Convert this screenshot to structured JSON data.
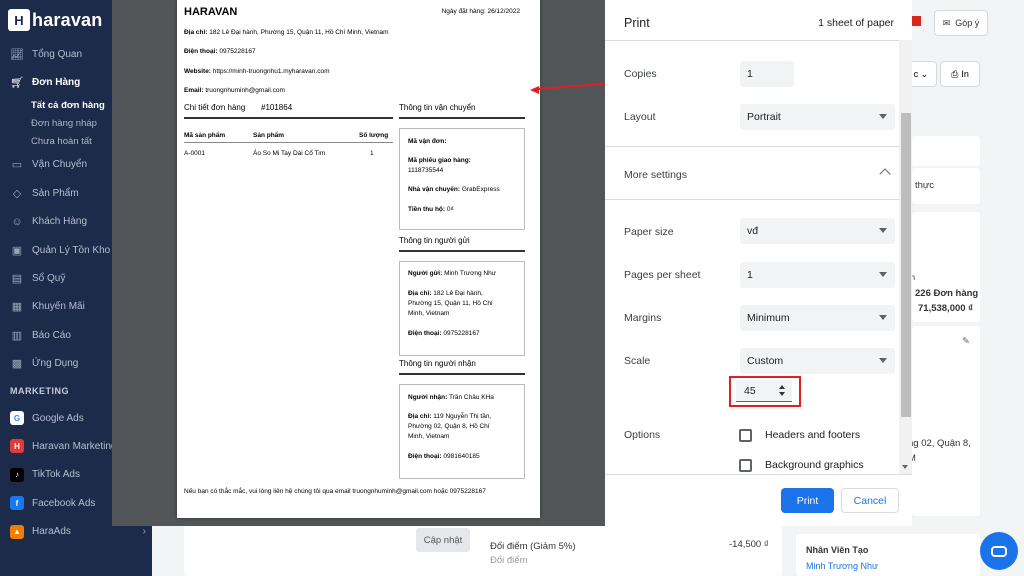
{
  "sidebar": {
    "logo": "haravan",
    "items": [
      {
        "label": "Tổng Quan",
        "icon": "chart-line-icon"
      },
      {
        "label": "Đơn Hàng",
        "icon": "cart-icon"
      },
      {
        "label": "Vận Chuyển",
        "icon": "truck-icon"
      },
      {
        "label": "Sản Phẩm",
        "icon": "tag-icon"
      },
      {
        "label": "Khách Hàng",
        "icon": "user-icon"
      },
      {
        "label": "Quản Lý Tồn Kho",
        "icon": "box-icon"
      },
      {
        "label": "Sổ Quỹ",
        "icon": "wallet-icon"
      },
      {
        "label": "Khuyến Mãi",
        "icon": "gift-icon"
      },
      {
        "label": "Báo Cáo",
        "icon": "report-icon"
      },
      {
        "label": "Ứng Dụng",
        "icon": "apps-icon"
      }
    ],
    "subitems": [
      "Tất cả đơn hàng",
      "Đơn hàng nháp",
      "Chưa hoàn tất"
    ],
    "marketing_title": "MARKETING",
    "marketing": [
      "Google Ads",
      "Haravan Marketing",
      "TikTok Ads",
      "Facebook Ads",
      "HaraAds"
    ]
  },
  "header": {
    "help": "Góp ý",
    "print_btn": "In"
  },
  "background": {
    "text_thuc": "thực",
    "text_m": "m",
    "orders": "226 Đơn hàng",
    "amount": "71,538,000 ₫",
    "addr_line1": "ng 02, Quận 8,",
    "addr_line2": "M",
    "update_btn": "Cập nhật",
    "points_label": "Đổi điểm (Giảm 5%)",
    "points_value": "-14,500 ₫",
    "points_label2": "Đổi điểm",
    "staff_title": "Nhân Viên Tạo",
    "staff_name": "Minh Trương Như"
  },
  "sheet": {
    "store": "HARAVAN",
    "order_date": "Ngày đặt hàng: 26/12/2022",
    "address_label": "Địa chỉ:",
    "address": "182 Lê Đại hành, Phường 15, Quận 11, Hồ Chí Minh, Vietnam",
    "phone_label": "Điện thoại:",
    "phone": "0975228167",
    "website_label": "Website:",
    "website": "https://minh-truongnhu1.myharavan.com",
    "email_label": "Email:",
    "email": "truongnhuminh@gmail.com",
    "detail_title": "Chi tiết đơn hàng",
    "order_no": "#101864",
    "col_sku": "Mã sản phẩm",
    "col_product": "Sản phẩm",
    "col_qty": "Số lượng",
    "row_sku": "A-0001",
    "row_product": "Áo So Mi Tay Dài Cổ Tim",
    "row_qty": "1",
    "ship_title": "Thông tin vận chuyển",
    "ship_code": "Mã vận đơn:",
    "ship_slip_label": "Mã phiếu giao hàng:",
    "ship_slip": "1118735544",
    "carrier_label": "Nhà vận chuyển:",
    "carrier": "GrabExpress",
    "cod_label": "Tiền thu hộ:",
    "cod": "0₫",
    "sender_title": "Thông tin người gửi",
    "sender_label": "Người gửi:",
    "sender": "Minh Trương Như",
    "sender_addr_label": "Địa chỉ:",
    "sender_addr1": "182 Lê Đại hành,",
    "sender_addr2": "Phường 15, Quận 11, Hồ Chí",
    "sender_addr3": "Minh, Vietnam",
    "sender_phone_label": "Điện thoại:",
    "sender_phone": "0975228167",
    "receiver_title": "Thông tin người nhận",
    "receiver_label": "Người nhận:",
    "receiver": "Trần Châu KHa",
    "receiver_addr_label": "Địa chỉ:",
    "receiver_addr1": "119 Nguyễn Thị tần,",
    "receiver_addr2": "Phường 02, Quận 8, Hồ Chí",
    "receiver_addr3": "Minh, Vietnam",
    "receiver_phone_label": "Điện thoại:",
    "receiver_phone": "0981640185",
    "footer": "Nếu bạn có thắc mắc, vui lòng liên hệ chúng tôi qua email truongnhuminh@gmail.com hoặc 0975228167"
  },
  "print_dialog": {
    "title": "Print",
    "sheets": "1 sheet of paper",
    "copies_label": "Copies",
    "copies": "1",
    "layout_label": "Layout",
    "layout": "Portrait",
    "more_settings": "More settings",
    "paper_label": "Paper size",
    "paper": "vđ",
    "pps_label": "Pages per sheet",
    "pps": "1",
    "margins_label": "Margins",
    "margins": "Minimum",
    "scale_label": "Scale",
    "scale": "Custom",
    "scale_value": "45",
    "options_label": "Options",
    "opt_headers": "Headers and footers",
    "opt_background": "Background graphics",
    "print_btn": "Print",
    "cancel_btn": "Cancel"
  },
  "colors": {
    "sidebar": "#1c2b4a",
    "accent": "#1a73e8",
    "annotation": "#e02020"
  }
}
